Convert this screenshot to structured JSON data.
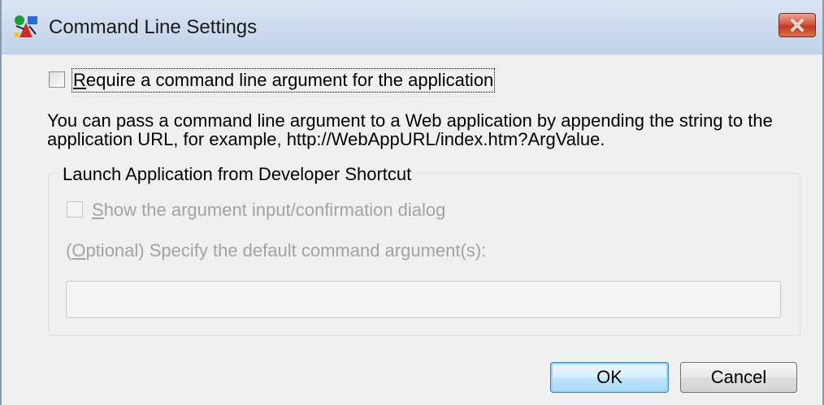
{
  "window": {
    "title": "Command Line Settings"
  },
  "require_checkbox": {
    "checked": false,
    "accel": "R",
    "rest": "equire a command line argument for the application"
  },
  "description": "You can pass a command line argument to a Web application by appending the string to the application URL, for example, http://WebAppURL/index.htm?ArgValue.",
  "group": {
    "title": "Launch Application from Developer Shortcut",
    "show_dialog": {
      "checked": false,
      "enabled": false,
      "accel": "S",
      "rest": "how the argument input/confirmation dialog"
    },
    "optional_label": {
      "prefix": "(",
      "accel": "O",
      "rest": "ptional) Specify the default command argument(s):"
    },
    "argument_input": {
      "value": "",
      "enabled": false
    }
  },
  "buttons": {
    "ok": "OK",
    "cancel": "Cancel"
  },
  "icons": {
    "app": "command-line-app-icon",
    "close": "close-icon"
  },
  "colors": {
    "close_button": "#c94a2e",
    "default_button_border": "#3c7fb1",
    "disabled_text": "#a3a3a3"
  }
}
